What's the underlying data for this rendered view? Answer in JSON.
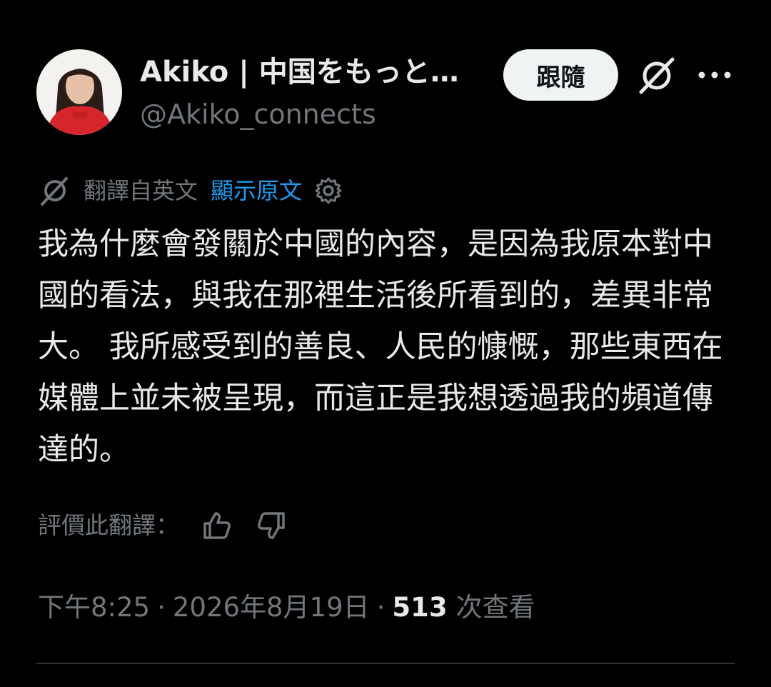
{
  "header": {
    "display_name": "Akiko | 中国をもっと…",
    "handle": "@Akiko_connects",
    "follow_label": "跟隨"
  },
  "icons": {
    "avatar": "avatar-photo",
    "grok": "grok-icon",
    "more": "more-icon",
    "translate": "grok-icon",
    "settings": "gear-icon",
    "thumbs_up": "thumbs-up-icon",
    "thumbs_down": "thumbs-down-icon"
  },
  "translation": {
    "label": "翻譯自英文",
    "show_original": "顯示原文"
  },
  "tweet": {
    "text": "我為什麼會發關於中國的內容，是因為我原本對中國的看法，與我在那裡生活後所看到的，差異非常大。 我所感受到的善良、人民的慷慨，那些東西在媒體上並未被呈現，而這正是我想透過我的頻道傳達的。"
  },
  "rating": {
    "label": "評價此翻譯："
  },
  "meta": {
    "time": "下午8:25",
    "separator": "·",
    "date": "2026年8月19日",
    "views_count": "513",
    "views_label": "次查看"
  },
  "colors": {
    "background": "#000000",
    "text_primary": "#e7e9ea",
    "text_secondary": "#71767b",
    "link": "#1d9bf0",
    "follow_bg": "#eff3f4",
    "avatar_shirt": "#d7262b"
  }
}
